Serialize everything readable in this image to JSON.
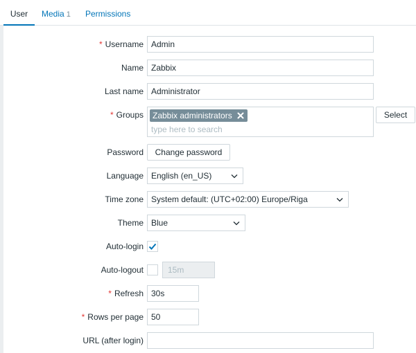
{
  "tabs": [
    {
      "label": "User"
    },
    {
      "label": "Media",
      "count": "1"
    },
    {
      "label": "Permissions"
    }
  ],
  "form": {
    "username": {
      "label": "Username",
      "value": "Admin"
    },
    "name": {
      "label": "Name",
      "value": "Zabbix"
    },
    "lastname": {
      "label": "Last name",
      "value": "Administrator"
    },
    "groups": {
      "label": "Groups",
      "tag": "Zabbix administrators",
      "placeholder": "type here to search",
      "select_label": "Select"
    },
    "password": {
      "label": "Password",
      "button": "Change password"
    },
    "language": {
      "label": "Language",
      "value": "English (en_US)"
    },
    "timezone": {
      "label": "Time zone",
      "value": "System default: (UTC+02:00) Europe/Riga"
    },
    "theme": {
      "label": "Theme",
      "value": "Blue"
    },
    "autologin": {
      "label": "Auto-login",
      "checked": true
    },
    "autologout": {
      "label": "Auto-logout",
      "checked": false,
      "value": "15m"
    },
    "refresh": {
      "label": "Refresh",
      "value": "30s"
    },
    "rows_per_page": {
      "label": "Rows per page",
      "value": "50"
    },
    "url": {
      "label": "URL (after login)",
      "value": ""
    }
  },
  "required_marker": "*",
  "colors": {
    "accent": "#0275b8",
    "required": "#e33734",
    "tag_bg": "#768d99"
  }
}
